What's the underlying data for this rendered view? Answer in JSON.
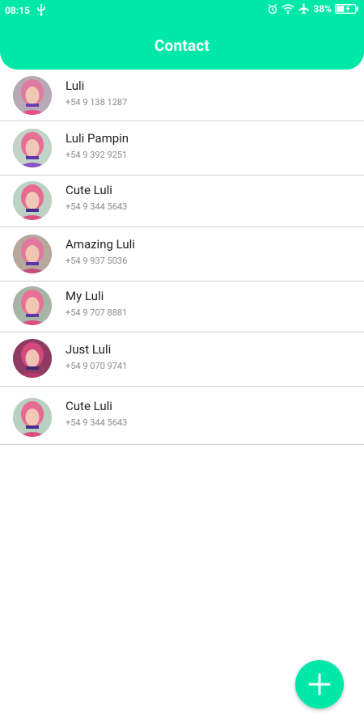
{
  "status": {
    "time": "08:15",
    "battery": "38%"
  },
  "header": {
    "title": "Contact"
  },
  "contacts": [
    {
      "name": "Luli",
      "phone": "+54 9 138 1287"
    },
    {
      "name": "Luli Pampin",
      "phone": "+54 9 392 9251"
    },
    {
      "name": "Cute Luli",
      "phone": "+54 9 344 5643"
    },
    {
      "name": "Amazing Luli",
      "phone": "+54 9 937 5036"
    },
    {
      "name": "My Luli",
      "phone": "+54 9 707 8881"
    },
    {
      "name": "Just Luli",
      "phone": "+54 9 070 9741"
    },
    {
      "name": "Cute Luli",
      "phone": "+54 9 344 5643"
    }
  ],
  "fab": {
    "icon": "plus-icon"
  },
  "colors": {
    "accent": "#00e8a8",
    "divider": "#cfcfcf"
  }
}
